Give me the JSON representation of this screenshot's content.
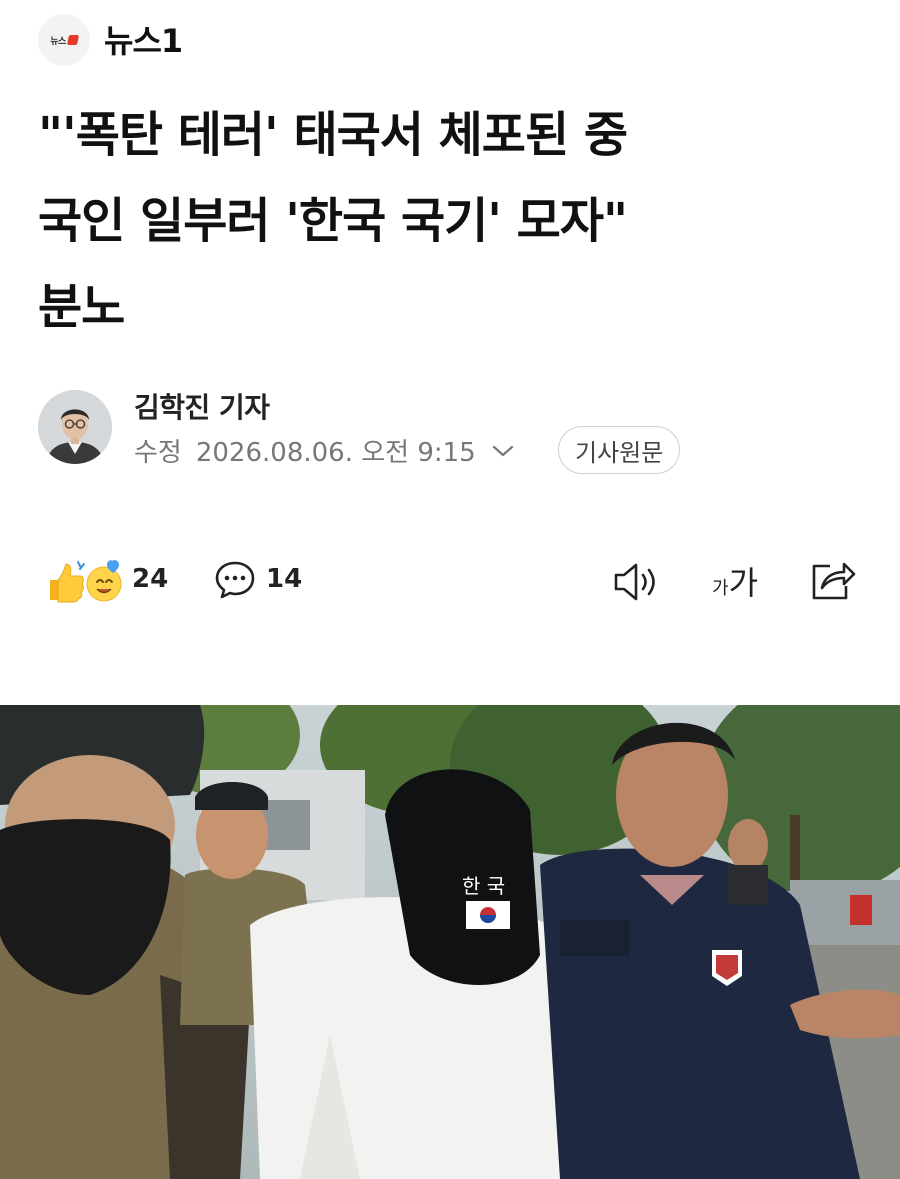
{
  "publisher": {
    "name": "뉴스1",
    "logo_text": "뉴스"
  },
  "article": {
    "headline_lines": [
      "\"'폭탄 테러' 태국서 체포된 중",
      "국인 일부러 '한국 국기' 모자\"",
      "분노"
    ],
    "author": "김학진 기자",
    "modified_label": "수정",
    "modified_datetime": "2026.08.06. 오전 9:15",
    "original_button": "기사원문"
  },
  "actions": {
    "reactions_count": "24",
    "comments_count": "14",
    "font_small": "가",
    "font_large": "가"
  },
  "photo": {
    "cap_text": "한 국"
  },
  "colors": {
    "brand_red": "#e8372b",
    "text": "#111111",
    "muted": "#777777"
  }
}
